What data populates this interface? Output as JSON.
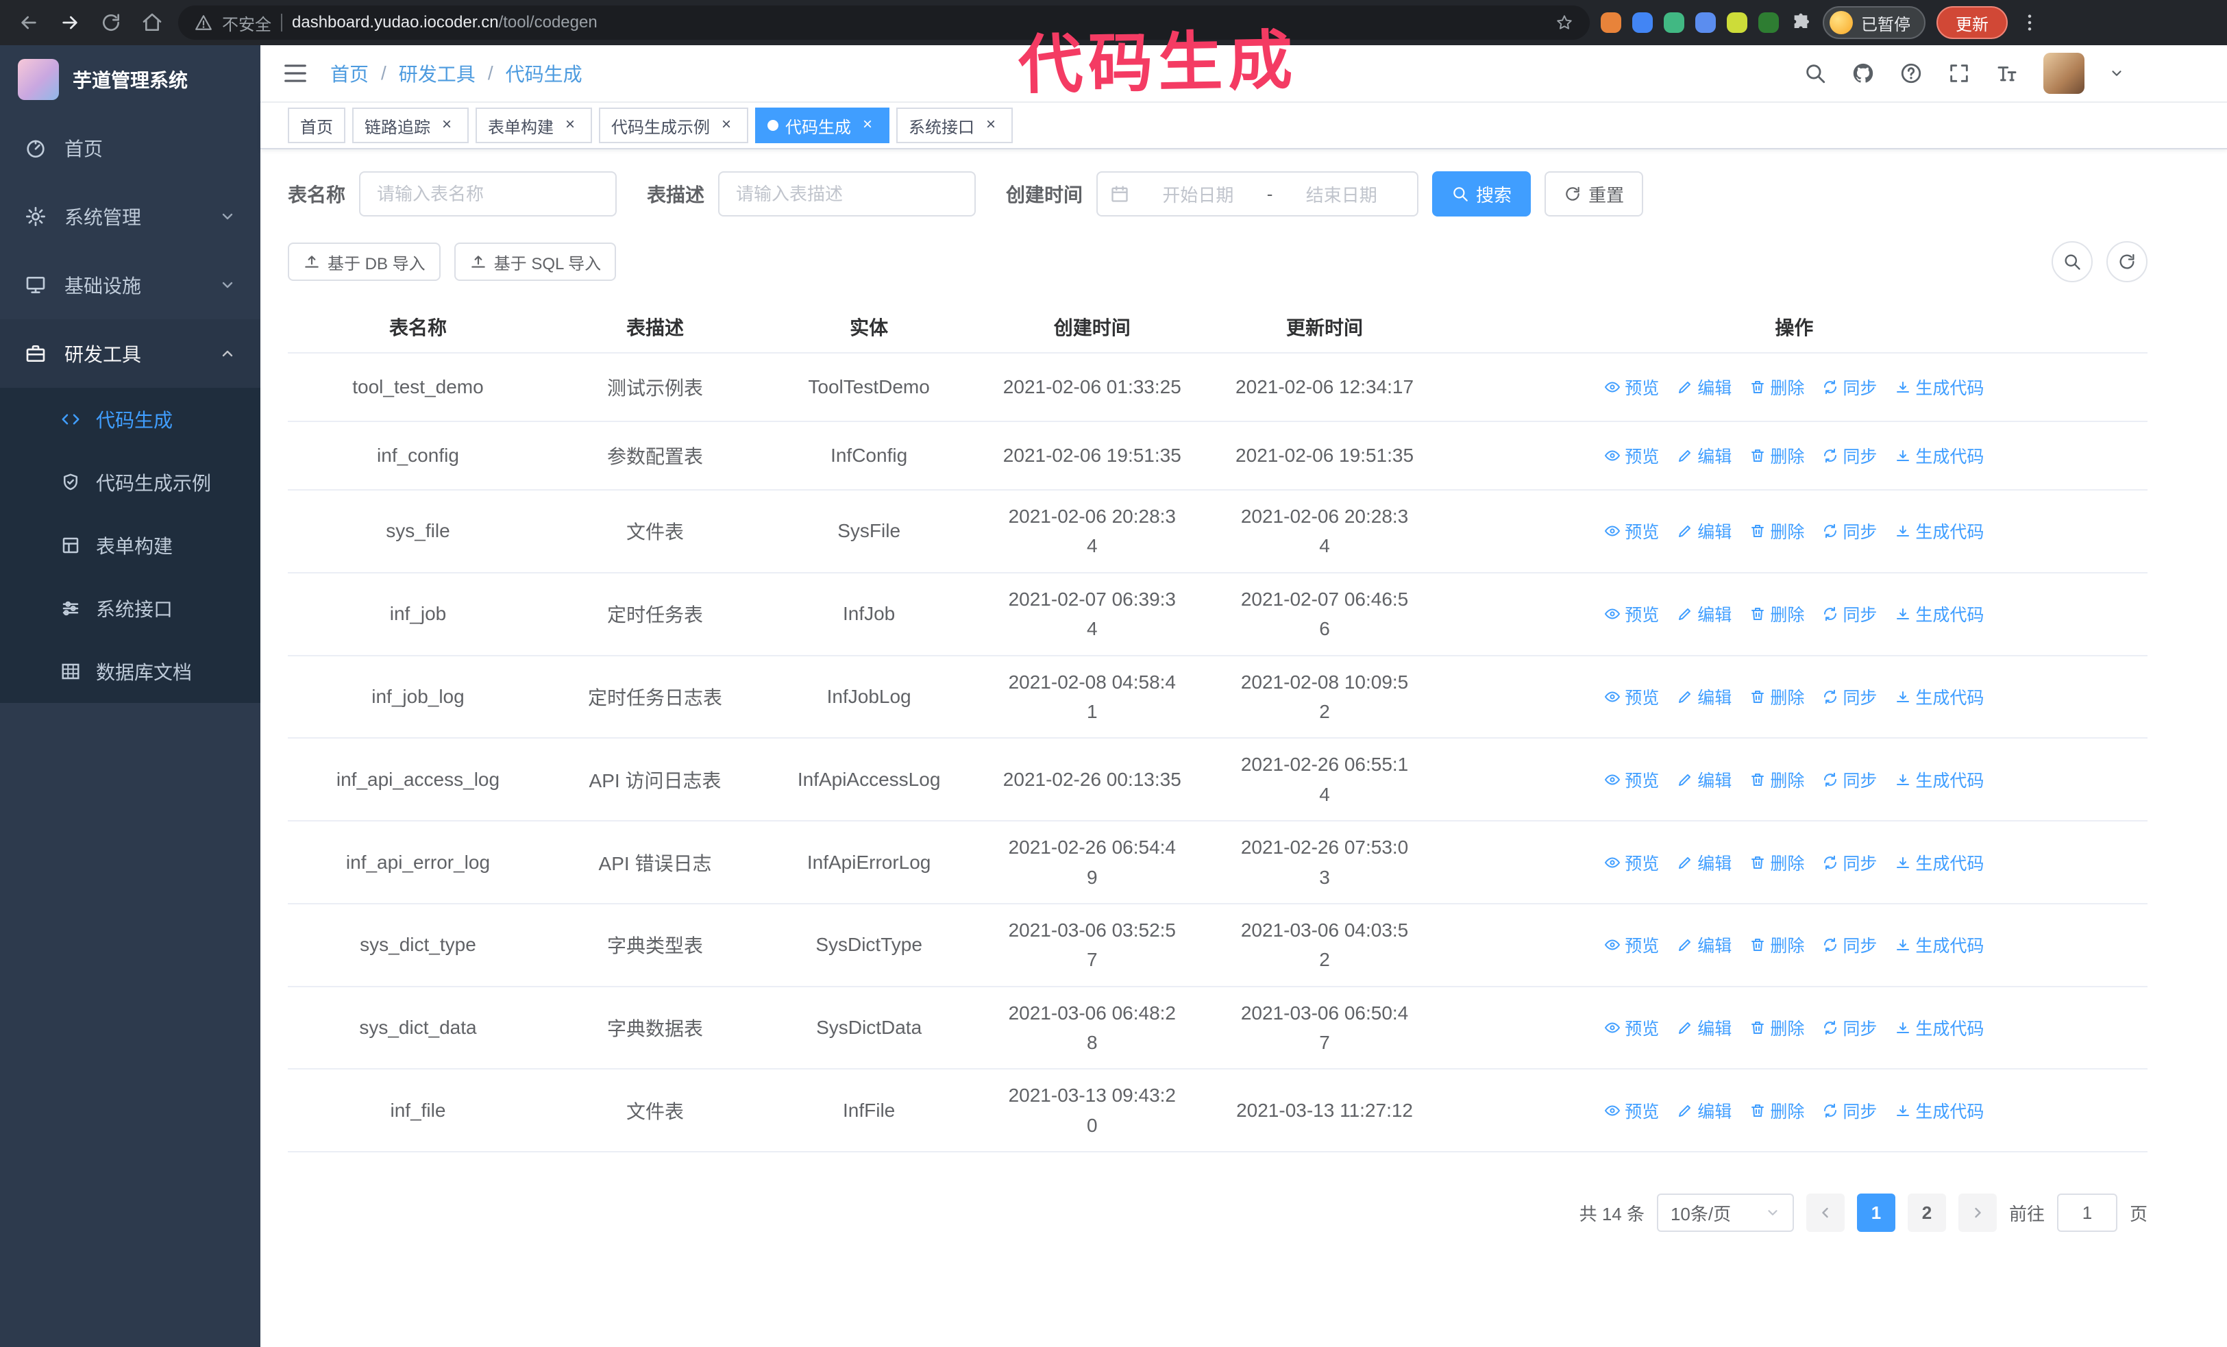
{
  "colors": {
    "primary": "#409eff",
    "annotation": "#f43b63",
    "update_button": "#d14836"
  },
  "annotation": {
    "text": "代码生成"
  },
  "browser": {
    "security_label": "不安全",
    "url_host": "dashboard.yudao.iocoder.cn",
    "url_path": "/tool/codegen",
    "paused_badge": "已暂停",
    "update_button": "更新",
    "extensions": [
      {
        "name": "extension-1",
        "color": "#e8833a"
      },
      {
        "name": "extension-2",
        "color": "#4285f4"
      },
      {
        "name": "extension-3",
        "color": "#41b883"
      },
      {
        "name": "extension-4",
        "color": "#5b8def"
      },
      {
        "name": "extension-5",
        "color": "#cddc39"
      },
      {
        "name": "extension-6",
        "color": "#2e7d32"
      }
    ]
  },
  "sidebar": {
    "app_title": "芋道管理系统",
    "items": [
      {
        "id": "home",
        "label": "首页",
        "icon": "dashboard"
      },
      {
        "id": "system",
        "label": "系统管理",
        "icon": "gear",
        "expandable": true
      },
      {
        "id": "infra",
        "label": "基础设施",
        "icon": "monitor",
        "expandable": true
      },
      {
        "id": "dev-tools",
        "label": "研发工具",
        "icon": "tool",
        "expandable": true,
        "expanded": true
      }
    ],
    "subitems": [
      {
        "id": "codegen",
        "label": "代码生成",
        "icon": "code",
        "active": true
      },
      {
        "id": "codegen-demo",
        "label": "代码生成示例",
        "icon": "shield"
      },
      {
        "id": "form-builder",
        "label": "表单构建",
        "icon": "form"
      },
      {
        "id": "api",
        "label": "系统接口",
        "icon": "sliders"
      },
      {
        "id": "db-doc",
        "label": "数据库文档",
        "icon": "table"
      }
    ]
  },
  "header": {
    "breadcrumb": [
      "首页",
      "研发工具",
      "代码生成"
    ],
    "separator": "/"
  },
  "tabs": [
    {
      "label": "首页",
      "closable": false
    },
    {
      "label": "链路追踪",
      "closable": true
    },
    {
      "label": "表单构建",
      "closable": true
    },
    {
      "label": "代码生成示例",
      "closable": true
    },
    {
      "label": "代码生成",
      "closable": true,
      "active": true
    },
    {
      "label": "系统接口",
      "closable": true
    }
  ],
  "filters": {
    "table_name_label": "表名称",
    "table_name_placeholder": "请输入表名称",
    "table_desc_label": "表描述",
    "table_desc_placeholder": "请输入表描述",
    "create_time_label": "创建时间",
    "date_start_placeholder": "开始日期",
    "date_separator": "-",
    "date_end_placeholder": "结束日期",
    "search_button": "搜索",
    "reset_button": "重置"
  },
  "toolbar": {
    "import_db": "基于 DB 导入",
    "import_sql": "基于 SQL 导入"
  },
  "table": {
    "columns": [
      "表名称",
      "表描述",
      "实体",
      "创建时间",
      "更新时间",
      "操作"
    ],
    "actions": [
      "预览",
      "编辑",
      "删除",
      "同步",
      "生成代码"
    ],
    "rows": [
      {
        "name": "tool_test_demo",
        "desc": "测试示例表",
        "entity": "ToolTestDemo",
        "created": "2021-02-06 01:33:25",
        "updated": "2021-02-06 12:34:17"
      },
      {
        "name": "inf_config",
        "desc": "参数配置表",
        "entity": "InfConfig",
        "created": "2021-02-06 19:51:35",
        "updated": "2021-02-06 19:51:35"
      },
      {
        "name": "sys_file",
        "desc": "文件表",
        "entity": "SysFile",
        "created": "2021-02-06 20:28:3\n4",
        "updated": "2021-02-06 20:28:3\n4"
      },
      {
        "name": "inf_job",
        "desc": "定时任务表",
        "entity": "InfJob",
        "created": "2021-02-07 06:39:3\n4",
        "updated": "2021-02-07 06:46:5\n6"
      },
      {
        "name": "inf_job_log",
        "desc": "定时任务日志表",
        "entity": "InfJobLog",
        "created": "2021-02-08 04:58:4\n1",
        "updated": "2021-02-08 10:09:5\n2"
      },
      {
        "name": "inf_api_access_log",
        "desc": "API 访问日志表",
        "entity": "InfApiAccessLog",
        "created": "2021-02-26 00:13:35",
        "updated": "2021-02-26 06:55:1\n4"
      },
      {
        "name": "inf_api_error_log",
        "desc": "API 错误日志",
        "entity": "InfApiErrorLog",
        "created": "2021-02-26 06:54:4\n9",
        "updated": "2021-02-26 07:53:0\n3"
      },
      {
        "name": "sys_dict_type",
        "desc": "字典类型表",
        "entity": "SysDictType",
        "created": "2021-03-06 03:52:5\n7",
        "updated": "2021-03-06 04:03:5\n2"
      },
      {
        "name": "sys_dict_data",
        "desc": "字典数据表",
        "entity": "SysDictData",
        "created": "2021-03-06 06:48:2\n8",
        "updated": "2021-03-06 06:50:4\n7"
      },
      {
        "name": "inf_file",
        "desc": "文件表",
        "entity": "InfFile",
        "created": "2021-03-13 09:43:2\n0",
        "updated": "2021-03-13 11:27:12"
      }
    ]
  },
  "pagination": {
    "total": "共 14 条",
    "page_size": "10条/页",
    "pages": [
      "1",
      "2"
    ],
    "active_page": "1",
    "goto_label": "前往",
    "goto_value": "1",
    "page_suffix": "页"
  }
}
